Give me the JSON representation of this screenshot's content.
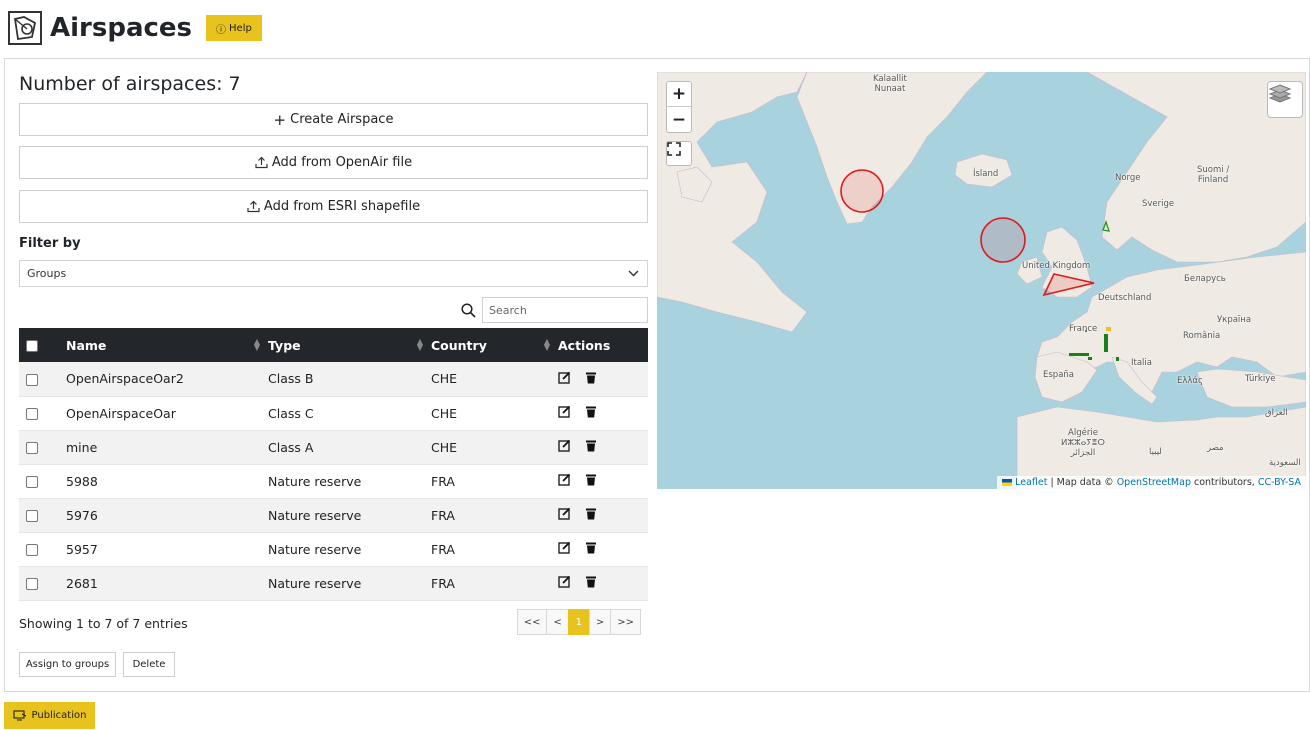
{
  "header": {
    "title": "Airspaces",
    "help_label": "Help"
  },
  "panel": {
    "count_label": "Number of airspaces: 7",
    "create_label": "Create Airspace",
    "openair_label": "Add from OpenAir file",
    "esri_label": "Add from ESRI shapefile",
    "filter_label": "Filter by",
    "groups_value": "Groups",
    "search_placeholder": "Search"
  },
  "table": {
    "columns": [
      "Name",
      "Type",
      "Country",
      "Actions"
    ],
    "rows": [
      {
        "name": "OpenAirspaceOar2",
        "type": "Class B",
        "country": "CHE"
      },
      {
        "name": "OpenAirspaceOar",
        "type": "Class C",
        "country": "CHE"
      },
      {
        "name": "mine",
        "type": "Class A",
        "country": "CHE"
      },
      {
        "name": "5988",
        "type": "Nature reserve",
        "country": "FRA"
      },
      {
        "name": "5976",
        "type": "Nature reserve",
        "country": "FRA"
      },
      {
        "name": "5957",
        "type": "Nature reserve",
        "country": "FRA"
      },
      {
        "name": "2681",
        "type": "Nature reserve",
        "country": "FRA"
      }
    ],
    "info": "Showing 1 to 7 of 7 entries",
    "pager": {
      "first": "<<",
      "prev": "<",
      "current": "1",
      "next": ">",
      "last": ">>"
    }
  },
  "bulk": {
    "assign_label": "Assign to groups",
    "delete_label": "Delete"
  },
  "map": {
    "labels": {
      "greenland": "Kalaallit\nNunaat",
      "iceland": "Ísland",
      "norway": "Norge",
      "finland": "Suomi /\nFinland",
      "sweden": "Sverige",
      "uk": "United Kingdom",
      "belarus": "Беларусь",
      "germany": "Deutschland",
      "ukraine": "Україна",
      "france": "France",
      "romania": "România",
      "spain": "España",
      "italy": "Italia",
      "greece": "Ελλάς",
      "turkey": "Türkiye",
      "iraq": "العراق",
      "algeria": "Algérie\nⵍⵣⵣⴰⵢⴻⵔ\nالجزائر",
      "libya": "ليبيا",
      "egypt": "مصر",
      "saudi": "السعودية"
    },
    "zoom_in": "+",
    "zoom_out": "−",
    "attribution_leaflet": "Leaflet",
    "attribution_mid": " | Map data © ",
    "attribution_osm": "OpenStreetMap",
    "attribution_contrib": " contributors, ",
    "attribution_license": "CC-BY-SA",
    "colors": {
      "water": "#a9d2df",
      "land": "#efeae3",
      "airspace": "#e0191b"
    }
  },
  "publication_label": "Publication"
}
